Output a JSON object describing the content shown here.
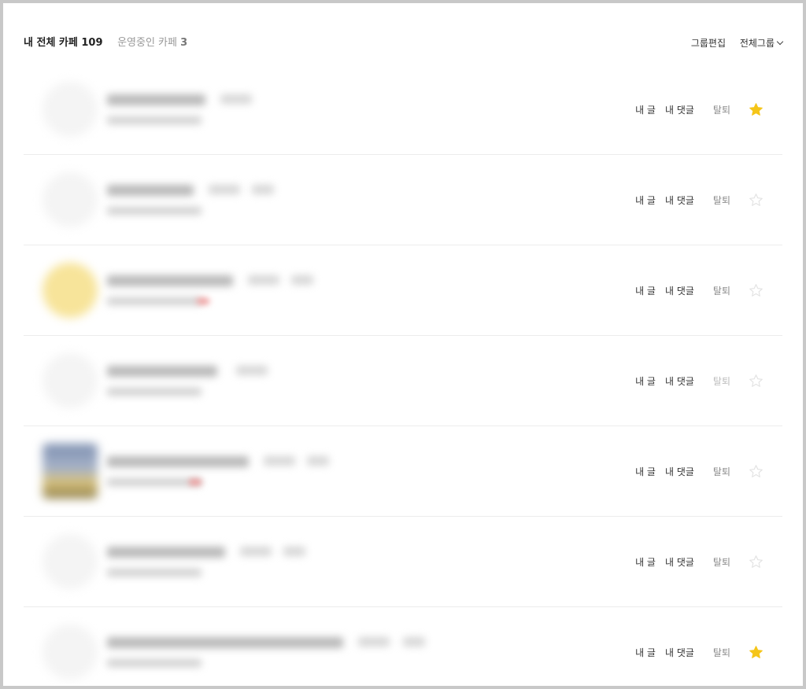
{
  "header": {
    "my_cafes_label": "내 전체 카페",
    "my_cafes_count": "109",
    "managed_cafes_label": "운영중인 카페",
    "managed_cafes_count": "3",
    "edit_group_label": "그룹편집",
    "group_filter_label": "전체그룹",
    "group_filter_icon": "chevron-down-icon"
  },
  "row_actions": {
    "my_posts": "내 글",
    "my_comments": "내 댓글",
    "leave": "탈퇴"
  },
  "rows": [
    {
      "favorite": true
    },
    {
      "favorite": false
    },
    {
      "favorite": false
    },
    {
      "favorite": false
    },
    {
      "favorite": false
    },
    {
      "favorite": false
    },
    {
      "favorite": true
    }
  ],
  "colors": {
    "star_on": "#f5c518",
    "star_off": "#e2e2e2",
    "frame_border": "#c8c8c8"
  }
}
